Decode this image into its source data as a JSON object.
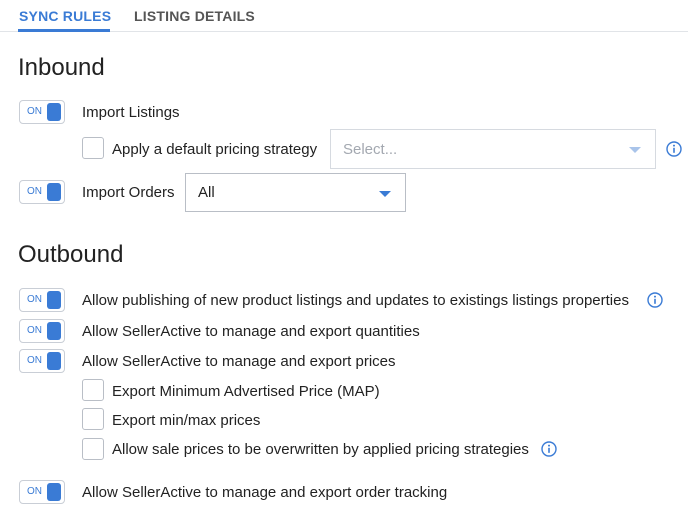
{
  "tabs": {
    "sync_rules": "SYNC RULES",
    "listing_details": "LISTING DETAILS"
  },
  "inbound": {
    "title": "Inbound",
    "import_listings": {
      "toggle": "ON",
      "label": "Import Listings"
    },
    "pricing_strategy": {
      "label": "Apply a default pricing strategy",
      "placeholder": "Select..."
    },
    "import_orders": {
      "toggle": "ON",
      "label": "Import Orders",
      "selected": "All"
    }
  },
  "outbound": {
    "title": "Outbound",
    "publishing": {
      "toggle": "ON",
      "label": "Allow publishing of new product listings and updates to existings listings properties"
    },
    "quantities": {
      "toggle": "ON",
      "label": "Allow SellerActive to manage and export quantities"
    },
    "prices": {
      "toggle": "ON",
      "label": "Allow SellerActive to manage and export prices"
    },
    "map": {
      "label": "Export Minimum Advertised Price (MAP)"
    },
    "minmax": {
      "label": "Export min/max prices"
    },
    "sale_prices": {
      "label": "Allow sale prices to be overwritten by applied pricing strategies"
    },
    "order_tracking": {
      "toggle": "ON",
      "label": "Allow SellerActive to manage and export order tracking"
    }
  },
  "colors": {
    "accent": "#3a7bd5",
    "caret_disabled": "#a9c4ea"
  }
}
